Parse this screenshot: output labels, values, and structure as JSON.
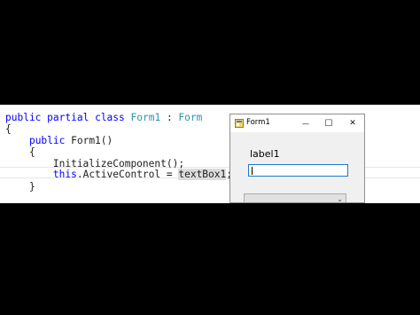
{
  "code": {
    "lines": [
      [
        {
          "t": "public",
          "c": "kw"
        },
        {
          "t": " ",
          "c": ""
        },
        {
          "t": "partial",
          "c": "kw"
        },
        {
          "t": " ",
          "c": ""
        },
        {
          "t": "class",
          "c": "kw"
        },
        {
          "t": " ",
          "c": ""
        },
        {
          "t": "Form1",
          "c": "type"
        },
        {
          "t": " : ",
          "c": ""
        },
        {
          "t": "Form",
          "c": "type"
        }
      ],
      [
        {
          "t": "{",
          "c": ""
        }
      ],
      [
        {
          "t": "    ",
          "c": ""
        },
        {
          "t": "public",
          "c": "kw"
        },
        {
          "t": " Form1()",
          "c": ""
        }
      ],
      [
        {
          "t": "    {",
          "c": ""
        }
      ],
      [
        {
          "t": "        InitializeComponent();",
          "c": ""
        }
      ],
      [
        {
          "t": "        ",
          "c": ""
        },
        {
          "t": "this",
          "c": "kw"
        },
        {
          "t": ".ActiveControl = ",
          "c": ""
        },
        {
          "t": "textBox1",
          "c": "hl"
        },
        {
          "t": ";",
          "c": ""
        }
      ],
      [
        {
          "t": "    }",
          "c": ""
        }
      ]
    ]
  },
  "form": {
    "title": "Form1",
    "minimize_glyph": "—",
    "maximize_glyph": "☐",
    "close_glyph": "✕",
    "label1": "label1",
    "combo_arrow": "⌄"
  },
  "colors": {
    "keyword": "#0000ff",
    "type": "#2b91af",
    "highlight": "#dcdcdc",
    "textbox_focus": "#1979ca"
  }
}
